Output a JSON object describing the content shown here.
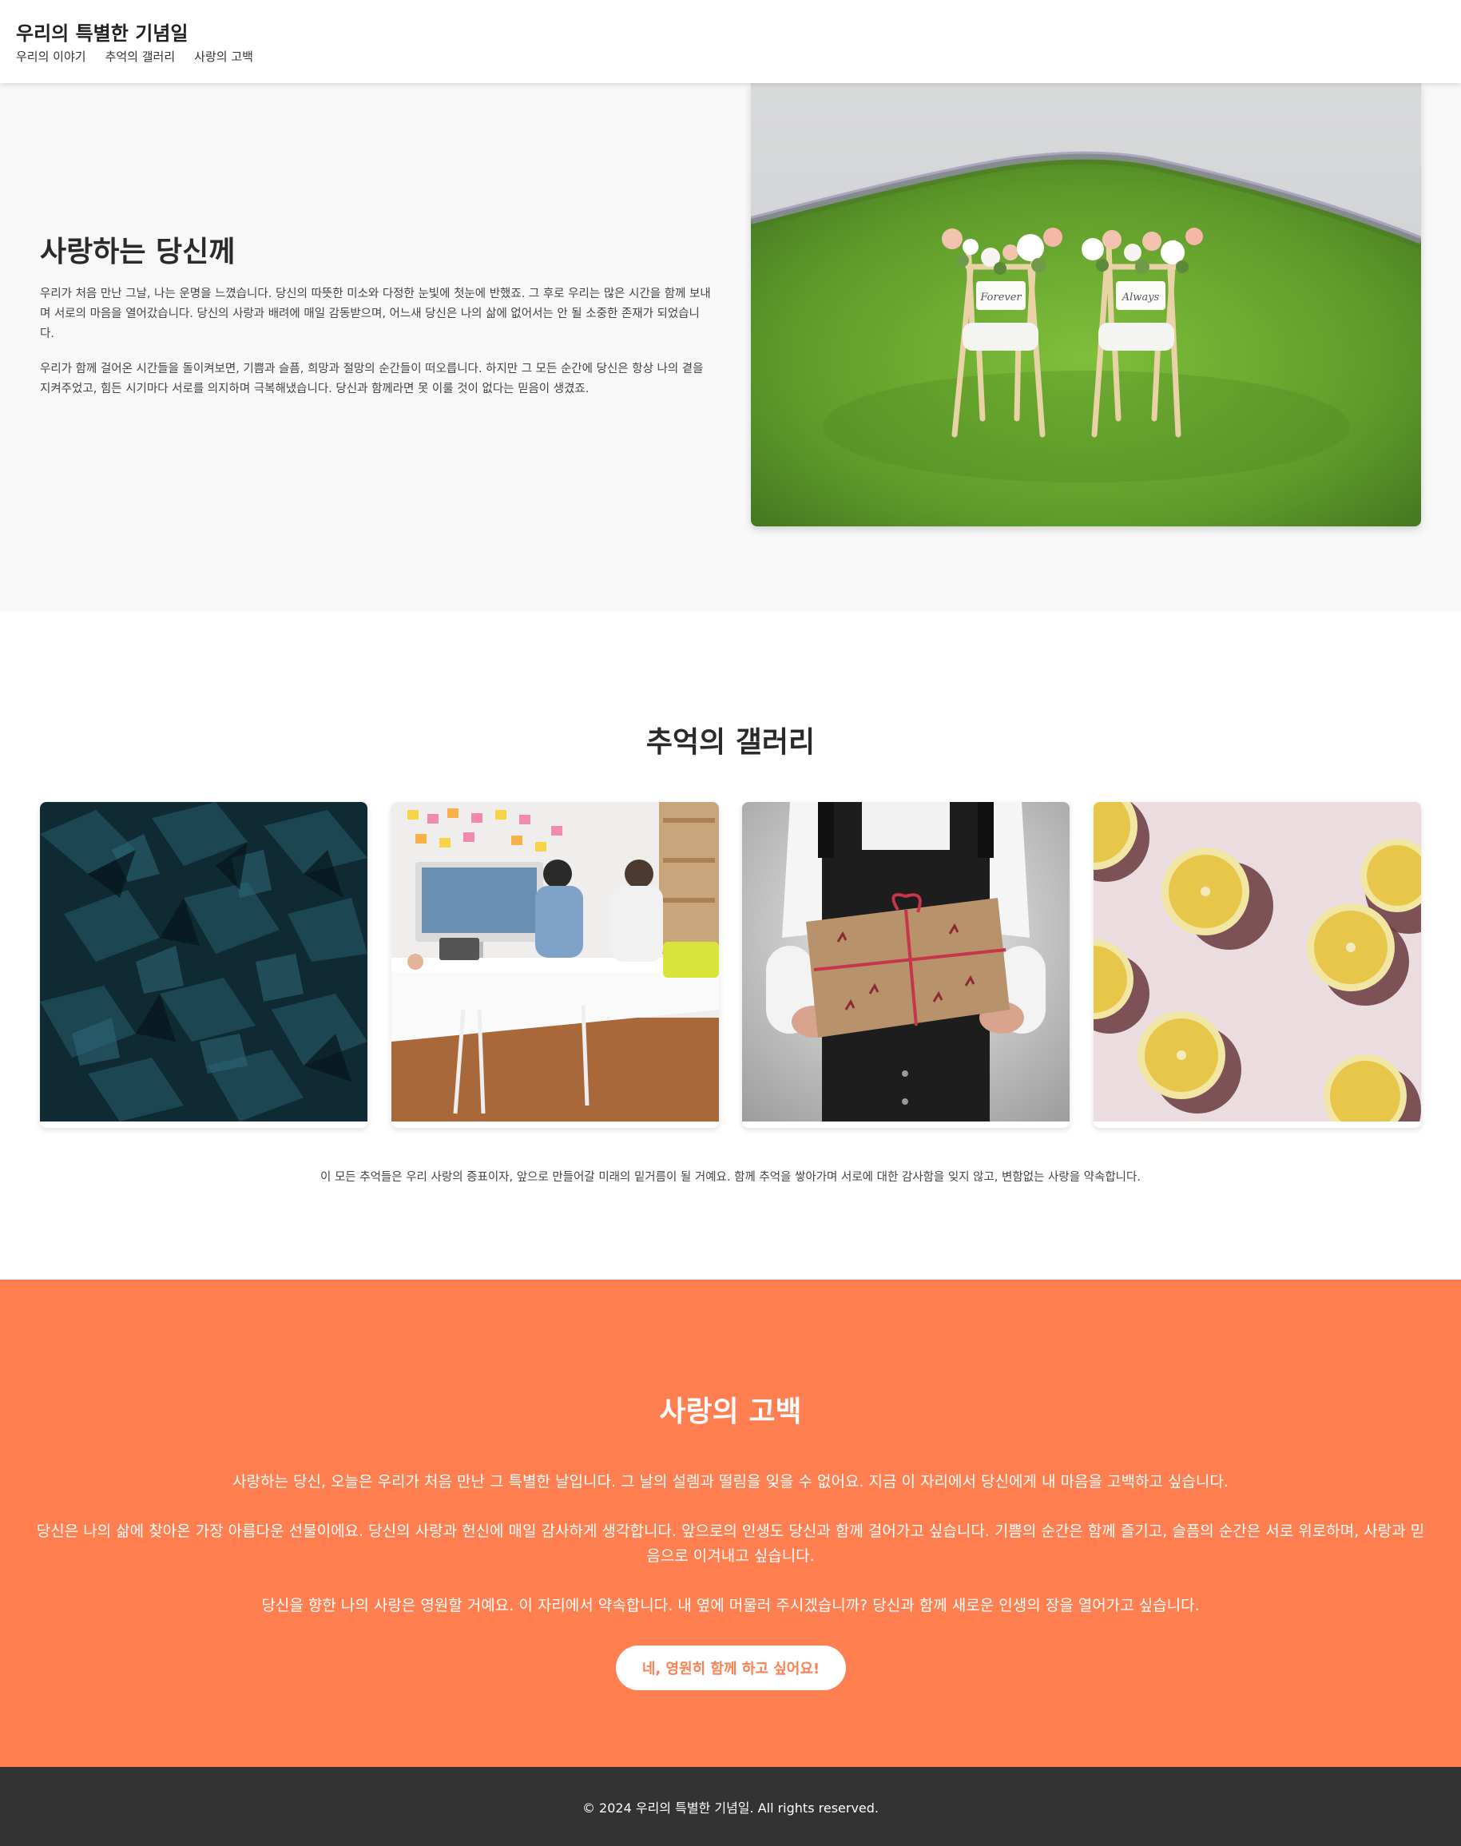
{
  "header": {
    "title": "우리의 특별한 기념일",
    "nav": [
      "우리의 이야기",
      "추억의 갤러리",
      "사랑의 고백"
    ]
  },
  "hero": {
    "title": "사랑하는 당신께",
    "paragraph1": "우리가 처음 만난 그날, 나는 운명을 느꼈습니다. 당신의 따뜻한 미소와 다정한 눈빛에 첫눈에 반했죠. 그 후로 우리는 많은 시간을 함께 보내며 서로의 마음을 열어갔습니다. 당신의 사랑과 배려에 매일 감동받으며, 어느새 당신은 나의 삶에 없어서는 안 될 소중한 존재가 되었습니다.",
    "paragraph2": "우리가 함께 걸어온 시간들을 돌이켜보면, 기쁨과 슬픔, 희망과 절망의 순간들이 떠오릅니다. 하지만 그 모든 순간에 당신은 항상 나의 곁을 지켜주었고, 힘든 시기마다 서로를 의지하며 극복해냈습니다. 당신과 함께라면 못 이룰 것이 없다는 믿음이 생겼죠.",
    "chair_sign_left": "Forever",
    "chair_sign_right": "Always"
  },
  "gallery": {
    "title": "추억의 갤러리",
    "caption": "이 모든 추억들은 우리 사랑의 증표이자, 앞으로 만들어갈 미래의 밑거름이 될 거예요. 함께 추억을 쌓아가며 서로에 대한 감사함을 잊지 않고, 변함없는 사랑을 약속합니다."
  },
  "confession": {
    "title": "사랑의 고백",
    "paragraph1": "사랑하는 당신, 오늘은 우리가 처음 만난 그 특별한 날입니다. 그 날의 설렘과 떨림을 잊을 수 없어요. 지금 이 자리에서 당신에게 내 마음을 고백하고 싶습니다.",
    "paragraph2": "당신은 나의 삶에 찾아온 가장 아름다운 선물이에요. 당신의 사랑과 헌신에 매일 감사하게 생각합니다. 앞으로의 인생도 당신과 함께 걸어가고 싶습니다. 기쁨의 순간은 함께 즐기고, 슬픔의 순간은 서로 위로하며, 사랑과 믿음으로 이겨내고 싶습니다.",
    "paragraph3": "당신을 향한 나의 사랑은 영원할 거예요. 이 자리에서 약속합니다. 내 옆에 머물러 주시겠습니까? 당신과 함께 새로운 인생의 장을 열어가고 싶습니다.",
    "button_label": "네, 영원히 함께 하고 싶어요!"
  },
  "footer": {
    "text": "© 2024 우리의 특별한 기념일. All rights reserved."
  },
  "colors": {
    "accent": "#ff7f50",
    "footer_bg": "#333333",
    "hero_bg": "#f8f8f8"
  }
}
